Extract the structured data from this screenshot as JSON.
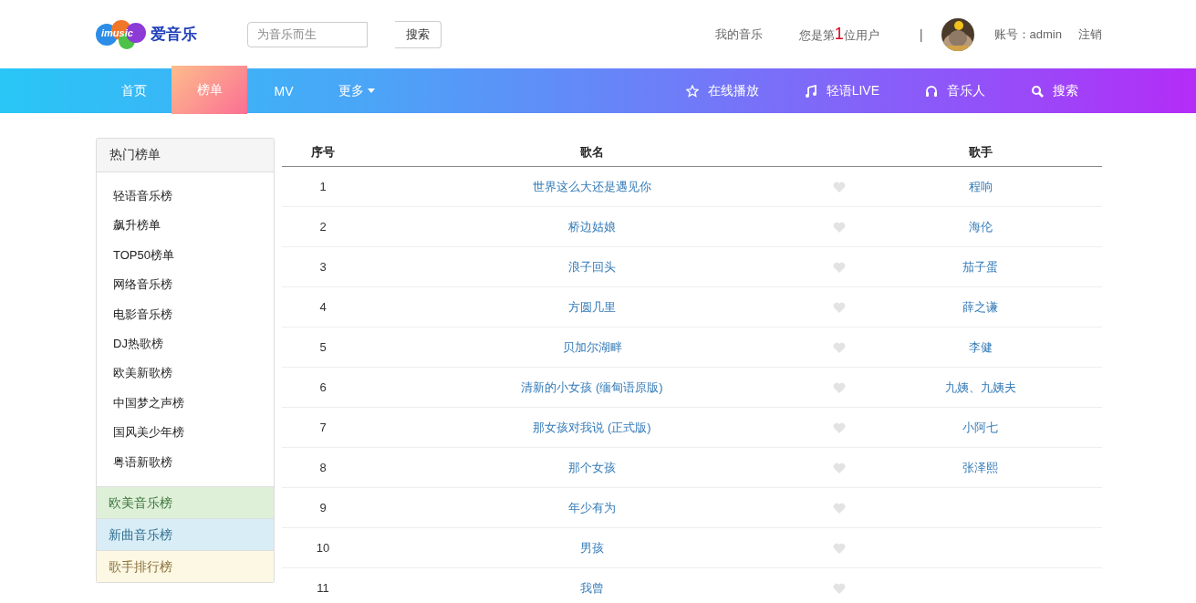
{
  "header": {
    "logo_mark": "imusic",
    "logo_text": "爱音乐",
    "search": {
      "placeholder": "为音乐而生",
      "button": "搜索"
    },
    "my_music": "我的音乐",
    "user_count": {
      "prefix": "您是第",
      "count": "1",
      "suffix": "位用户"
    },
    "separator": "|",
    "account": "账号：admin",
    "logout": "注销"
  },
  "nav": {
    "items": [
      {
        "label": "首页",
        "selected": false
      },
      {
        "label": "榜单",
        "selected": true
      },
      {
        "label": "MV",
        "selected": false
      },
      {
        "label": "更多",
        "selected": false,
        "dropdown": true
      }
    ],
    "right_items": [
      {
        "label": "在线播放"
      },
      {
        "label": "轻语LIVE"
      },
      {
        "label": "音乐人"
      },
      {
        "label": "搜索"
      }
    ]
  },
  "sidebar": {
    "title": "热门榜单",
    "items": [
      "轻语音乐榜",
      "飙升榜单",
      "TOP50榜单",
      "网络音乐榜",
      "电影音乐榜",
      "DJ热歌榜",
      "欧美新歌榜",
      "中国梦之声榜",
      "国风美少年榜",
      "粤语新歌榜"
    ],
    "extra_items": [
      {
        "label": "欧美音乐榜",
        "kind": "success"
      },
      {
        "label": "新曲音乐榜",
        "kind": "info"
      },
      {
        "label": "歌手排行榜",
        "kind": "warning"
      }
    ]
  },
  "table": {
    "columns": [
      "序号",
      "歌名",
      "歌手"
    ],
    "rows": [
      {
        "no": "1",
        "song": "世界这么大还是遇见你",
        "singer": "程响"
      },
      {
        "no": "2",
        "song": "桥边姑娘",
        "singer": "海伦"
      },
      {
        "no": "3",
        "song": "浪子回头",
        "singer": "茄子蛋"
      },
      {
        "no": "4",
        "song": "方圆几里",
        "singer": "薛之谦"
      },
      {
        "no": "5",
        "song": "贝加尔湖畔",
        "singer": "李健"
      },
      {
        "no": "6",
        "song": "清新的小女孩 (缅甸语原版)",
        "singer": "九姨、九姨夫"
      },
      {
        "no": "7",
        "song": "那女孩对我说 (正式版)",
        "singer": "小阿七"
      },
      {
        "no": "8",
        "song": "那个女孩",
        "singer": "张泽熙"
      },
      {
        "no": "9",
        "song": "年少有为"
      },
      {
        "no": "10",
        "song": "男孩"
      },
      {
        "no": "11",
        "song": "我曾"
      }
    ]
  }
}
